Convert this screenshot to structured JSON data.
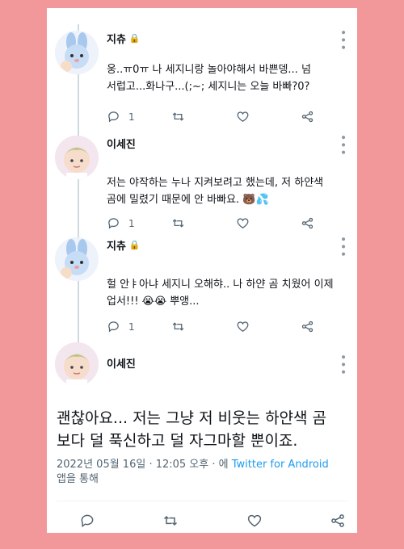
{
  "colors": {
    "background": "#F2989A",
    "card": "#FFFFFF",
    "link": "#1D9BF0",
    "muted": "#536471"
  },
  "tweets": [
    {
      "name": "지츄",
      "lock_icon": "lock-icon",
      "text": "웅..ㅠ0ㅠ 나 세지니랑 놀아야해서 바쁜뎅... 넘\n서럽고...화나구...(;~; 세지니는 오늘 바빠?0?",
      "reply_count": "1",
      "retweet_count": "",
      "like_count": ""
    },
    {
      "name": "이세진",
      "text": "저는 야작하는 누나 지켜보려고 했는데, 저 하얀색\n곰에 밀렸기 때문에 안 바빠요. 🐻💦",
      "reply_count": "1",
      "retweet_count": "",
      "like_count": ""
    },
    {
      "name": "지츄",
      "lock_icon": "lock-icon",
      "text": "헐 안ㅑ아냐 세지니 오해햐.. 나 하얀 곰 치웠어 이제\n업서!!! 😭😭 뿌앵...",
      "reply_count": "1",
      "retweet_count": "",
      "like_count": ""
    }
  ],
  "main_tweet": {
    "name": "이세진",
    "text": "괜찮아요... 저는 그냥 저 비웃는 하얀색 곰\n보다 덜 푹신하고 덜 자그마할 뿐이죠.",
    "timestamp": "2022년 05월 16일 · 12:05 오후 · 에 ",
    "source": "Twitter for Android",
    "source_suffix": "앱을 통해"
  }
}
